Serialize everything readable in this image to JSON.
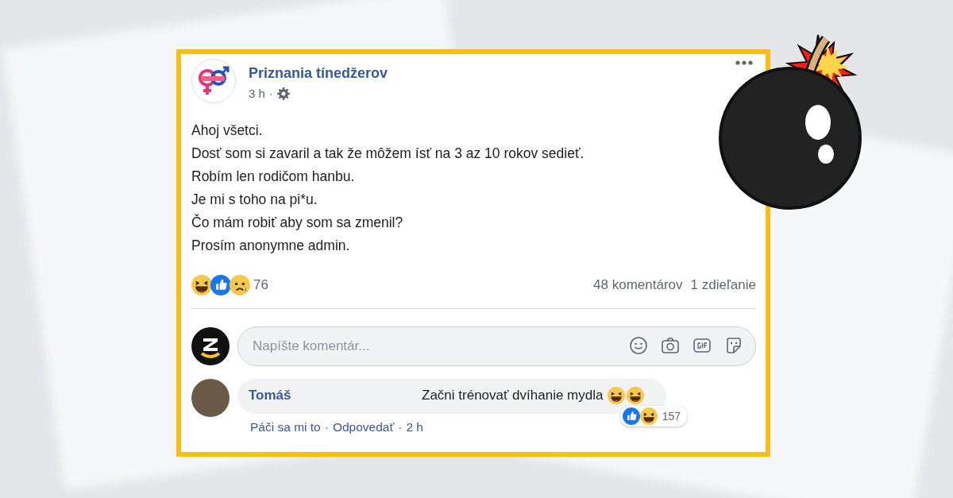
{
  "post": {
    "page_name": "Priznania tínedžerov",
    "time": "3 h",
    "separator": "·",
    "body_lines": [
      "Ahoj všetci.",
      "Dosť som si zavaril a tak že môžem ísť na 3 az 10 rokov sedieť.",
      "Robím len rodičom hanbu.",
      "Je mi s toho na pi*u.",
      "Čo mám robiť aby som sa zmenil?",
      "Prosím anonymne admin."
    ],
    "reaction_count": "76",
    "comments_count": "48 komentárov",
    "shares_count": "1 zdieľanie"
  },
  "comment_box": {
    "placeholder": "Napíšte komentár..."
  },
  "comments": [
    {
      "author": "Tomáš",
      "text": "Začni trénovať dvíhanie mydla",
      "reaction_count": "157",
      "actions": [
        {
          "label": "Páči sa mi to",
          "separator": "·"
        },
        {
          "label": "Odpovedať",
          "separator": "·"
        }
      ],
      "time": "2 h"
    }
  ]
}
